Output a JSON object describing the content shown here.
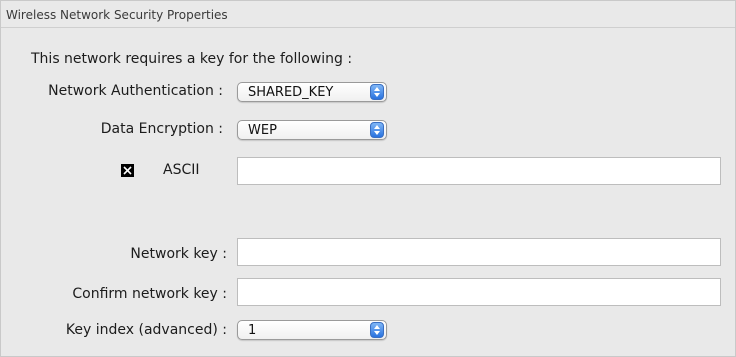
{
  "panel": {
    "title": "Wireless Network Security Properties"
  },
  "intro": "This network requires a key for the following :",
  "auth": {
    "label": "Network Authentication :",
    "value": "SHARED_KEY"
  },
  "encryption": {
    "label": "Data Encryption :",
    "value": "WEP"
  },
  "ascii": {
    "label": "ASCII",
    "checked": true,
    "value": ""
  },
  "network_key": {
    "label": "Network key :",
    "value": ""
  },
  "confirm_key": {
    "label": "Confirm network key :",
    "value": ""
  },
  "key_index": {
    "label": "Key index (advanced) :",
    "value": "1"
  },
  "colors": {
    "panel_bg": "#e9e9e9",
    "stepper_blue": "#2a73df"
  }
}
